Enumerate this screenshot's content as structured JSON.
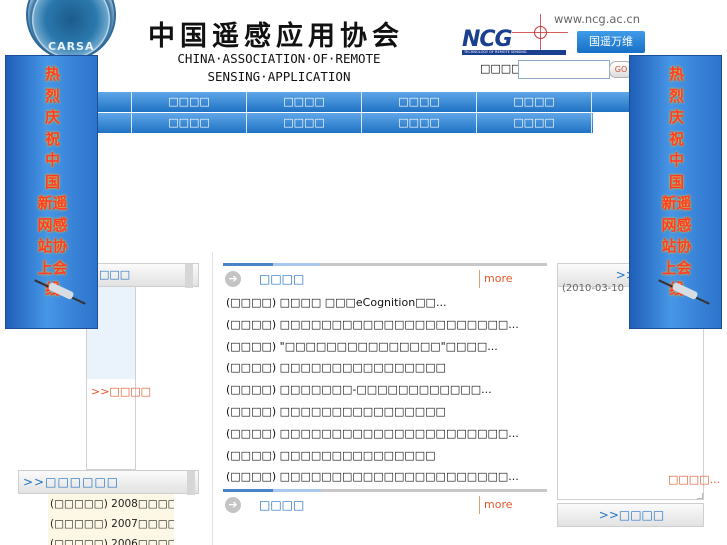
{
  "header": {
    "logo_text": "CARSA",
    "title_cn": "中国遥感应用协会",
    "title_en_line1": "CHINA·ASSOCIATION·OF·REMOTE",
    "title_en_line2": "SENSING·APPLICATION",
    "partner_logo": "NCG",
    "partner_tagline": "TECHNOLOGY OF REMOTE SENSING",
    "site_url": "www.ncg.ac.cn",
    "partner_button": "国遥万维",
    "search_label": "□□□□",
    "search_value": "",
    "search_button": "GO"
  },
  "nav": {
    "row1": [
      "□□□□",
      "□□□□",
      "□□□□",
      "□□□□"
    ],
    "row2": [
      "□□□□",
      "□□□□",
      "□□□□",
      "□□□□"
    ]
  },
  "banner": {
    "text": "热烈庆祝中国新遥网感站协上会线",
    "left_lines": [
      "热",
      "烈",
      "庆",
      "祝",
      "中",
      "国",
      "新遥",
      "网感",
      "站协",
      "上会",
      "线"
    ],
    "right_lines": [
      "热",
      "烈",
      "庆",
      "祝",
      "中",
      "国",
      "新遥",
      "网感",
      "站协",
      "上会",
      "线"
    ]
  },
  "left_panel": {
    "title": "□□□",
    "more": ">>□□□□"
  },
  "conference": {
    "title": ">>□□□□□□",
    "items": [
      "(□□□□□) 2008□□□□□...",
      "(□□□□□) 2007□□□□□...",
      "(□□□□□) 2006□□□□□..."
    ]
  },
  "news": {
    "title": "□□□□",
    "more": "more",
    "items": [
      "(□□□□) □□□□ □□□eCognition□□...",
      "(□□□□) □□□□□□□□□□□□□□□□□□□□□□...",
      "(□□□□) \"□□□□□□□□□□□□□□□\"□□□□...",
      "(□□□□) □□□□□□□□□□□□□□□□",
      "(□□□□) □□□□□□□-□□□□□□□□□□□□...",
      "(□□□□) □□□□□□□□□□□□□□□□",
      "(□□□□) □□□□□□□□□□□□□□□□□□□□□□...",
      "(□□□□) □□□□□□□□□□□□□□□",
      "(□□□□) □□□□□□□□□□□□□□□□□□□□□□..."
    ]
  },
  "news2": {
    "title": "□□□□",
    "more": "more"
  },
  "right_panel": {
    "title": ">>□",
    "date": "(2010-03-10",
    "more": "□□□□...",
    "bottom_title": ">>□□□□"
  }
}
